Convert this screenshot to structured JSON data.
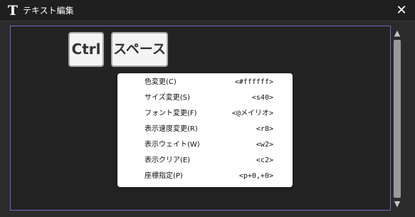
{
  "window": {
    "title": "テキスト編集",
    "app_icon": "T",
    "close_label": "✕"
  },
  "editor": {
    "keys": [
      {
        "label": "Ctrl"
      },
      {
        "label": "スペース"
      }
    ]
  },
  "context_menu": {
    "items": [
      {
        "label": "色変更(C)",
        "tag": "<#ffffff>"
      },
      {
        "label": "サイズ変更(S)",
        "tag": "<s40>"
      },
      {
        "label": "フォント変更(F)",
        "tag": "<@メイリオ>"
      },
      {
        "label": "表示速度変更(R)",
        "tag": "<r8>"
      },
      {
        "label": "表示ウェイト(W)",
        "tag": "<w2>"
      },
      {
        "label": "表示クリア(E)",
        "tag": "<c2>"
      },
      {
        "label": "座標指定(P)",
        "tag": "<p+0,+0>"
      }
    ]
  },
  "scrollbar": {
    "up_icon": "▲",
    "down_icon": "▼"
  },
  "colors": {
    "window_bg": "#2b2b2b",
    "titlebar_bg": "#1f1f1f",
    "frame_border": "#6a6ac8",
    "key_bg": "#f4f4f4",
    "menu_bg": "#ffffff"
  }
}
